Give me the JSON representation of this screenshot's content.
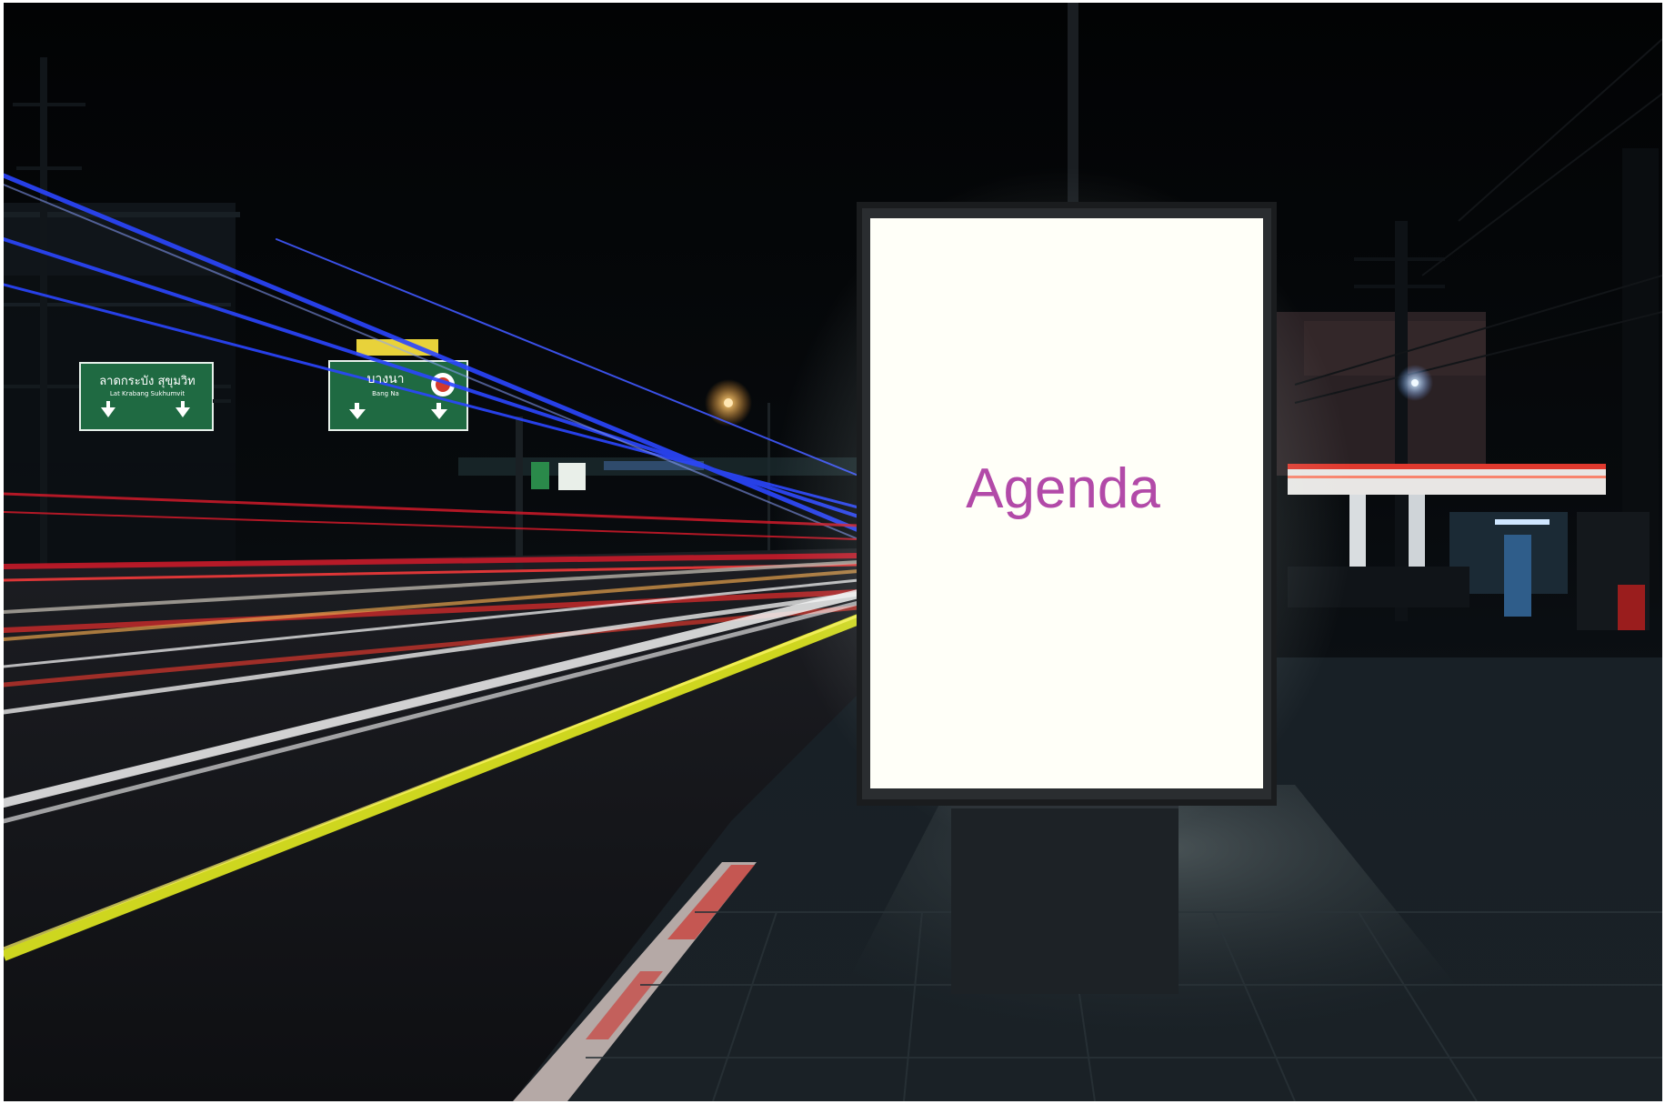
{
  "poster": {
    "headline": "Agenda",
    "headline_color": "#b24aa8",
    "panel_color": "#fffff8"
  },
  "road_signs": [
    {
      "line1": "ลาดกระบัง  สุขุมวิท",
      "line2": "Lat Krabang   Sukhumvit"
    },
    {
      "line1": "บางนา",
      "line2": "Bang Na"
    }
  ],
  "scene": {
    "description_icons": [
      "billboard-icon",
      "street-light-icon",
      "gas-station-icon"
    ]
  }
}
